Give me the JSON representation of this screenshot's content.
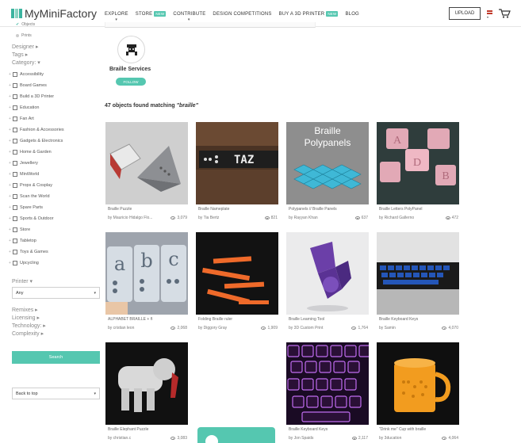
{
  "header": {
    "logo_text": "MyMiniFactory",
    "nav": [
      {
        "label": "EXPLORE",
        "badge": "",
        "caret": true
      },
      {
        "label": "STORE",
        "badge": "NEW",
        "caret": false
      },
      {
        "label": "CONTRIBUTE",
        "badge": "",
        "caret": true
      },
      {
        "label": "DESIGN COMPETITIONS",
        "badge": "",
        "caret": false
      },
      {
        "label": "BUY A 3D PRINTER",
        "badge": "NEW",
        "caret": false
      },
      {
        "label": "BLOG",
        "badge": "",
        "caret": false
      }
    ],
    "upload_label": "UPLOAD"
  },
  "sidebar": {
    "objects_label": "Objects",
    "prints_label": "Prints",
    "designer_label": "Designer ▸",
    "tags_label": "Tags ▸",
    "category_label": "Category: ▾",
    "categories": [
      "Accessibility",
      "Board Games",
      "Build a 3D Printer",
      "Education",
      "Fan Art",
      "Fashion & Accessories",
      "Gadgets & Electronics",
      "Home & Garden",
      "Jewellery",
      "MiniWorld",
      "Props & Cosplay",
      "Scan the World",
      "Spare Parts",
      "Sports & Outdoor",
      "Store",
      "Tabletop",
      "Toys & Games",
      "Upcycling"
    ],
    "printer_label": "Printer ▾",
    "printer_value": "Any",
    "remixes_label": "Remixes ▸",
    "licensing_label": "Licensing ▸",
    "technology_label": "Technology: ▸",
    "complexity_label": "Complexity ▸",
    "search_label": "Search",
    "back_to_top_label": "Back to top"
  },
  "creator": {
    "name": "Braille Services",
    "follow_label": "FOLLOW"
  },
  "results": {
    "prefix": "47 objects found matching ",
    "query": "\"braille\""
  },
  "cards": [
    {
      "title": "Braille Puzzle",
      "author": "by Mauricio Hidalgo Flo...",
      "views": "3,079"
    },
    {
      "title": "Braille Nameplate",
      "author": "by Tia Bertz",
      "views": "821"
    },
    {
      "title": "Polypanels // Braille Panels",
      "author": "by Rayyan Khan",
      "views": "637"
    },
    {
      "title": "Braille Letters PolyPanel",
      "author": "by Richard Gallerno",
      "views": "472"
    },
    {
      "title": "ALPHABET BRAILLE + ñ",
      "author": "by cristian leon",
      "views": "2,068"
    },
    {
      "title": "Folding Braille ruler",
      "author": "by Diggory Gray",
      "views": "1,909"
    },
    {
      "title": "Braille Learning Tool",
      "author": "by 3D Custom Print",
      "views": "1,764"
    },
    {
      "title": "Braille Keyboard Keys",
      "author": "by Samin",
      "views": "4,070"
    },
    {
      "title": "Braille Elephant Puzzle",
      "author": "by christian.c",
      "views": "3,083"
    },
    {
      "title": "Braille Keyboard Keys",
      "author": "by Jon Spaids",
      "views": "2,117"
    },
    {
      "title": "\"Drink me\" Cup with braille",
      "author": "by 3ducation",
      "views": "4,064"
    }
  ],
  "thumb_text": {
    "nameplate": "TAZ",
    "poly_line1": "Braille",
    "poly_line2": "Polypanels",
    "letter_a": "A",
    "letter_b": "B",
    "letter_d": "D",
    "abc_a": "a",
    "abc_b": "b",
    "abc_c": "c"
  },
  "colors": {
    "accent": "#55c7b0",
    "badge": "#55c7b0"
  }
}
